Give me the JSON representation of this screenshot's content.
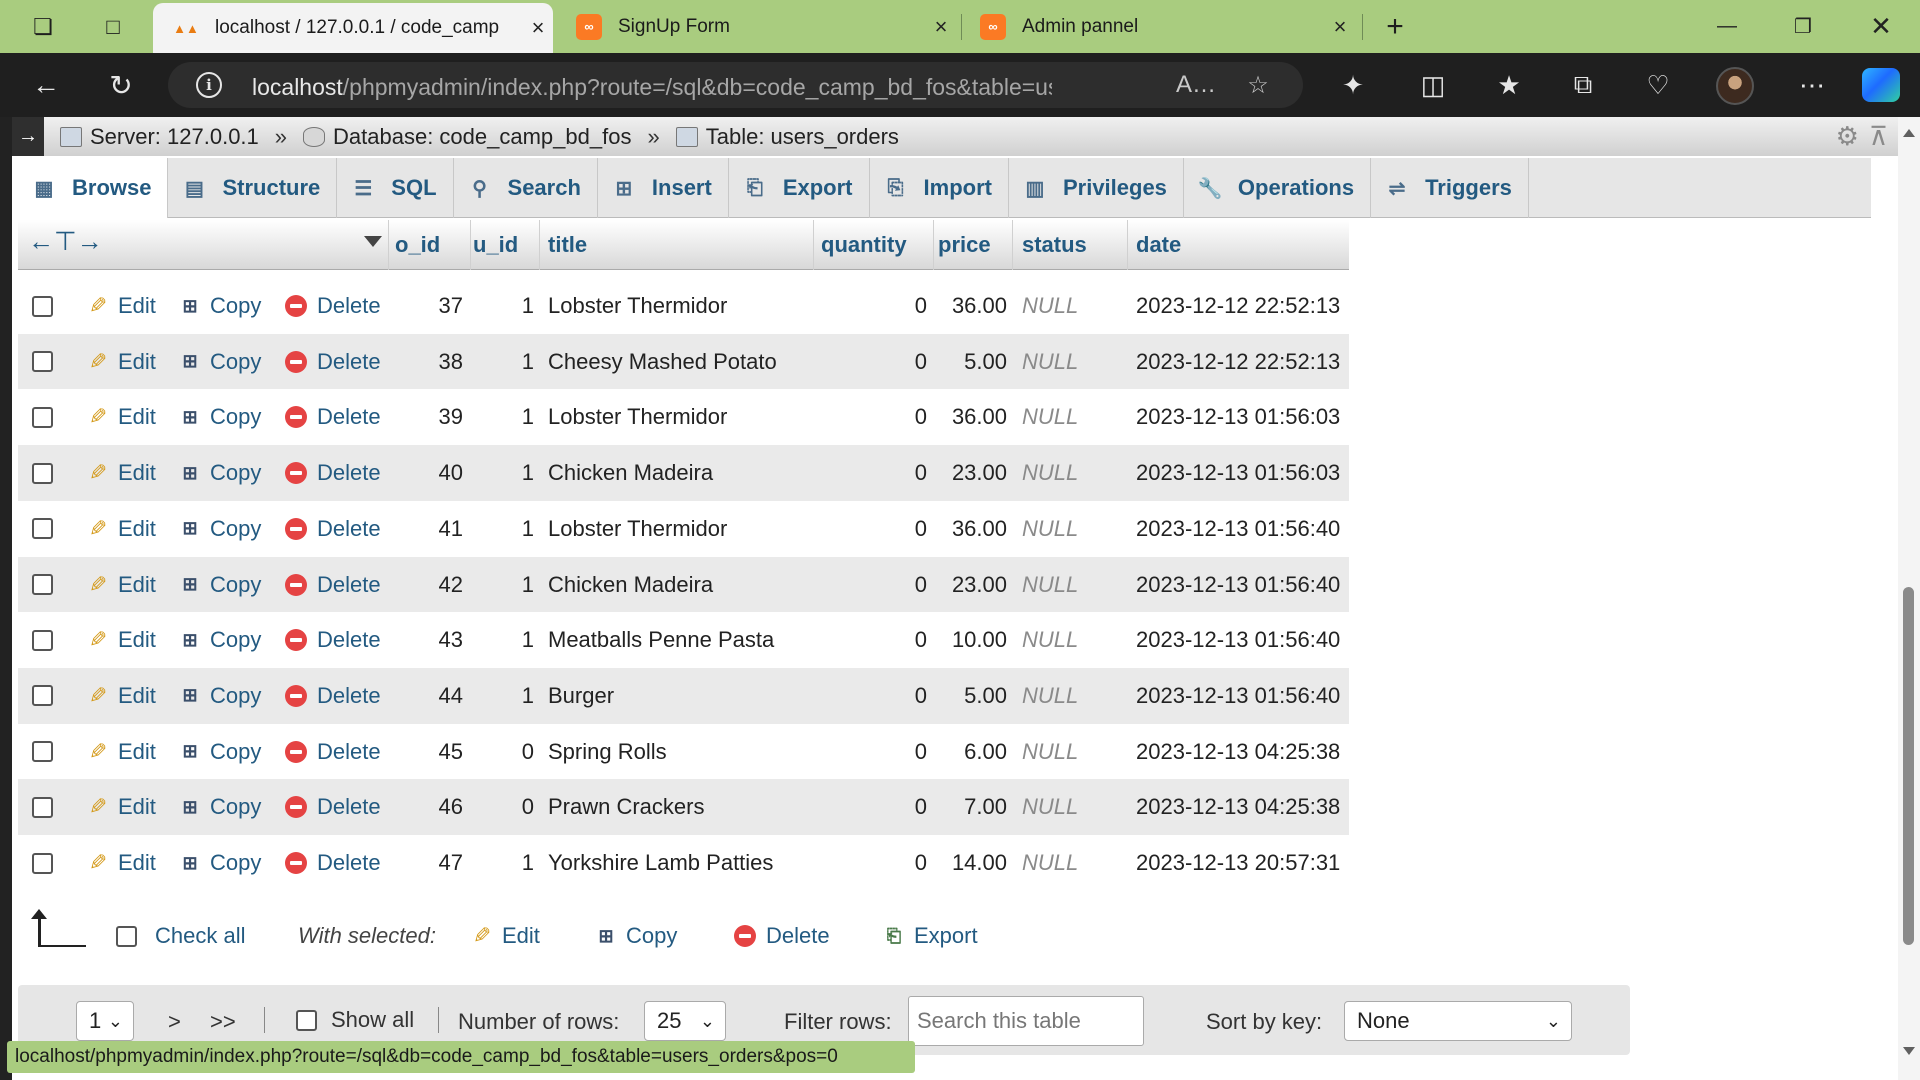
{
  "browser": {
    "tabs": [
      {
        "title": "localhost / 127.0.0.1 / code_camp",
        "favicon": "phpmyadmin-icon",
        "active": true
      },
      {
        "title": "SignUp Form",
        "favicon": "xampp-icon",
        "active": false
      },
      {
        "title": "Admin pannel",
        "favicon": "xampp-icon",
        "active": false
      }
    ],
    "url_host": "localhost",
    "url_rest": "/phpmyadmin/index.php?route=/sql&db=code_camp_bd_fos&table=users_..."
  },
  "breadcrumb": {
    "server": "Server: 127.0.0.1",
    "database": "Database: code_camp_bd_fos",
    "table": "Table: users_orders",
    "separator": "»"
  },
  "tabs": [
    {
      "label": "Browse",
      "icon": "browse-icon"
    },
    {
      "label": "Structure",
      "icon": "structure-icon"
    },
    {
      "label": "SQL",
      "icon": "sql-icon"
    },
    {
      "label": "Search",
      "icon": "search-icon"
    },
    {
      "label": "Insert",
      "icon": "insert-icon"
    },
    {
      "label": "Export",
      "icon": "export-icon"
    },
    {
      "label": "Import",
      "icon": "import-icon"
    },
    {
      "label": "Privileges",
      "icon": "privileges-icon"
    },
    {
      "label": "Operations",
      "icon": "operations-icon"
    },
    {
      "label": "Triggers",
      "icon": "triggers-icon"
    }
  ],
  "table": {
    "columns": [
      "o_id",
      "u_id",
      "title",
      "quantity",
      "price",
      "status",
      "date"
    ],
    "actions": {
      "edit": "Edit",
      "copy": "Copy",
      "delete": "Delete"
    },
    "rows": [
      {
        "o_id": "37",
        "u_id": "1",
        "title": "Lobster Thermidor",
        "quantity": "0",
        "price": "36.00",
        "status": "NULL",
        "date": "2023-12-12 22:52:13"
      },
      {
        "o_id": "38",
        "u_id": "1",
        "title": "Cheesy Mashed Potato",
        "quantity": "0",
        "price": "5.00",
        "status": "NULL",
        "date": "2023-12-12 22:52:13"
      },
      {
        "o_id": "39",
        "u_id": "1",
        "title": "Lobster Thermidor",
        "quantity": "0",
        "price": "36.00",
        "status": "NULL",
        "date": "2023-12-13 01:56:03"
      },
      {
        "o_id": "40",
        "u_id": "1",
        "title": "Chicken Madeira",
        "quantity": "0",
        "price": "23.00",
        "status": "NULL",
        "date": "2023-12-13 01:56:03"
      },
      {
        "o_id": "41",
        "u_id": "1",
        "title": "Lobster Thermidor",
        "quantity": "0",
        "price": "36.00",
        "status": "NULL",
        "date": "2023-12-13 01:56:40"
      },
      {
        "o_id": "42",
        "u_id": "1",
        "title": "Chicken Madeira",
        "quantity": "0",
        "price": "23.00",
        "status": "NULL",
        "date": "2023-12-13 01:56:40"
      },
      {
        "o_id": "43",
        "u_id": "1",
        "title": "Meatballs Penne Pasta",
        "quantity": "0",
        "price": "10.00",
        "status": "NULL",
        "date": "2023-12-13 01:56:40"
      },
      {
        "o_id": "44",
        "u_id": "1",
        "title": "Burger",
        "quantity": "0",
        "price": "5.00",
        "status": "NULL",
        "date": "2023-12-13 01:56:40"
      },
      {
        "o_id": "45",
        "u_id": "0",
        "title": "Spring Rolls",
        "quantity": "0",
        "price": "6.00",
        "status": "NULL",
        "date": "2023-12-13 04:25:38"
      },
      {
        "o_id": "46",
        "u_id": "0",
        "title": "Prawn Crackers",
        "quantity": "0",
        "price": "7.00",
        "status": "NULL",
        "date": "2023-12-13 04:25:38"
      },
      {
        "o_id": "47",
        "u_id": "1",
        "title": "Yorkshire Lamb Patties",
        "quantity": "0",
        "price": "14.00",
        "status": "NULL",
        "date": "2023-12-13 20:57:31"
      }
    ]
  },
  "with_selected": {
    "check_all": "Check all",
    "label": "With selected:",
    "edit": "Edit",
    "copy": "Copy",
    "delete": "Delete",
    "export": "Export"
  },
  "navigation": {
    "page": "1",
    "next": ">",
    "last": ">>",
    "show_all": "Show all",
    "rows_label": "Number of rows:",
    "rows_value": "25",
    "filter_label": "Filter rows:",
    "filter_placeholder": "Search this table",
    "sort_label": "Sort by key:",
    "sort_value": "None"
  },
  "status_url": "localhost/phpmyadmin/index.php?route=/sql&db=code_camp_bd_fos&table=users_orders&pos=0",
  "colors": {
    "browser_accent": "#a9cc7f",
    "link": "#235a81",
    "delete": "#e54343"
  }
}
